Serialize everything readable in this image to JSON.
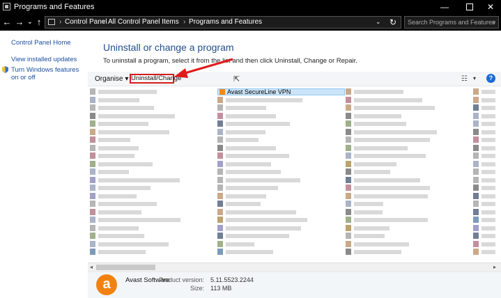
{
  "window": {
    "title": "Programs and Features",
    "min_glyph": "—",
    "close_glyph": "✕"
  },
  "address": {
    "back": "←",
    "forward": "→",
    "down": "⌄",
    "up": "↑",
    "crumbs": [
      "Control Panel",
      "All Control Panel Items",
      "Programs and Features"
    ],
    "separator": "›",
    "dropdown": "⌄",
    "refresh": "↻",
    "search_placeholder": "Search Programs and Features",
    "search_glyph": "⌕"
  },
  "sidebar": {
    "items": [
      "Control Panel Home",
      "View installed updates",
      "Turn Windows features on or off"
    ]
  },
  "main": {
    "heading": "Uninstall or change a program",
    "instructions": "To uninstall a program, select it from the list and then click Uninstall, Change or Repair."
  },
  "toolbar": {
    "organise_label": "Organise ▾",
    "uninstall_label": "Uninstall/Change",
    "view_glyph": "☷",
    "view_dropdown": "▾",
    "help_label": "?"
  },
  "list": {
    "selected_item": "Avast SecureLine VPN"
  },
  "scrollbar": {
    "left": "◂",
    "right": "▸"
  },
  "details": {
    "publisher": "Avast Software",
    "version_label": "Product version:",
    "version_value": "5.11.5523.2244",
    "size_label": "Size:",
    "size_value": "113 MB",
    "icon_letter": "a"
  },
  "colors": {
    "accent": "#1b6ad6",
    "highlight": "#d31c1c",
    "avast_orange": "#f2820f",
    "selection": "#cce4f7"
  }
}
